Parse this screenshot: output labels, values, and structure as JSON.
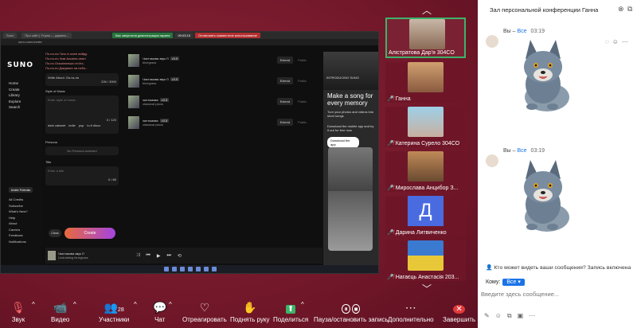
{
  "shared_screen": {
    "tabs": [
      "Suno",
      "Про сайт | Утром — дарина...",
      "Новая вкладка"
    ],
    "banner_green": "Вас запустили демонстрация экрана",
    "banner_time": "00:03:15",
    "banner_red": "Остановить совместное использование",
    "address": "suno.com/create",
    "suno": {
      "logo": "SUNO",
      "nav": [
        "Home",
        "Create",
        "Library",
        "Explore",
        "Search"
      ],
      "invite": "Invite Friends",
      "bottom_nav": [
        "All Credits",
        "Subscribe",
        "What's New?",
        "Help",
        "About",
        "Careers",
        "Feedback",
        "Notifications"
      ],
      "lyrics": [
        "По-по-на Тихо в оселі вийду.",
        "По-по-по Чим Аксинія святі.",
        "По-по Осьмінонька стоїть.",
        "По-по-по Дякувати на небо..."
      ],
      "write_about": "Write About: Ла-та-ля",
      "char_count": "226 / 3000",
      "style_label": "Style of Music",
      "style_placeholder": "Enter style of music",
      "style_tags": [
        "dark cabaret",
        "indie",
        "pop",
        "lo-fi disco"
      ],
      "style_count": "0 / 120",
      "persona_label": "Persona",
      "persona_value": "No Persona selected",
      "title_label": "Title",
      "title_placeholder": "Enter a title",
      "title_count": "0 / 80",
      "clear_label": "Clear",
      "create_label": "Create",
      "songs": [
        {
          "title": "Чистомова звук Л",
          "genre": "bluegrass",
          "version": "v3.5",
          "extend": "Extend",
          "public": "Public"
        },
        {
          "title": "Чистомова звук Л",
          "genre": "bluegrass",
          "version": "v3.5",
          "extend": "Extend",
          "public": "Public"
        },
        {
          "title": "чистомова",
          "genre": "classical piano",
          "version": "v3.5",
          "extend": "Extend",
          "public": "Public"
        },
        {
          "title": "чистомова",
          "genre": "classical piano",
          "version": "v3.5",
          "extend": "Extend",
          "public": "Public"
        }
      ],
      "promo": {
        "tag": "INTRODUCING SUNO",
        "headline": "Make a song for every memory",
        "desc": "Turn your photos and videos into short songs",
        "desc2": "Download the mobile app and try it out for free now",
        "download": "Download the app"
      },
      "player": {
        "title": "Чистомова звук Л",
        "sub": "Undulating bluegrass"
      }
    }
  },
  "participants": [
    {
      "name": "Алістратова Дар'я 304СО",
      "active": true,
      "muted": false
    },
    {
      "name": "Ганна",
      "active": false,
      "muted": true
    },
    {
      "name": "Катерина Сурело 304СО",
      "active": false,
      "muted": true
    },
    {
      "name": "Мирослава Анцибор З...",
      "active": false,
      "muted": true
    },
    {
      "name": "Дарина Литвиченко",
      "active": false,
      "muted": true,
      "avatar_letter": "Д"
    },
    {
      "name": "Нагаєць Анастасія 203...",
      "active": false,
      "muted": true
    }
  ],
  "toolbar": {
    "audio": "Звук",
    "video": "Видео",
    "participants": "Участники",
    "participants_count": "28",
    "chat": "Чат",
    "react": "Отреагировать",
    "raise_hand": "Поднять руку",
    "share": "Поделиться",
    "record": "Пауза/остановить запись",
    "more": "Дополнительно",
    "end": "Завершить"
  },
  "chat": {
    "title": "Зал персональной конференции Ганна",
    "messages": [
      {
        "prefix": "Вы – ",
        "to": "Все",
        "time": "03:19"
      },
      {
        "prefix": "Вы – ",
        "to": "Все",
        "time": "03:19"
      }
    ],
    "privacy": "Кто может видеть ваши сообщения? Запись включена",
    "to_label": "Кому:",
    "to_value": "Все",
    "placeholder": "Введите здесь сообщение..."
  },
  "colors": {
    "accent": "#1a73e8",
    "active_border": "#3db36a",
    "bg": "#7a1a2c"
  }
}
